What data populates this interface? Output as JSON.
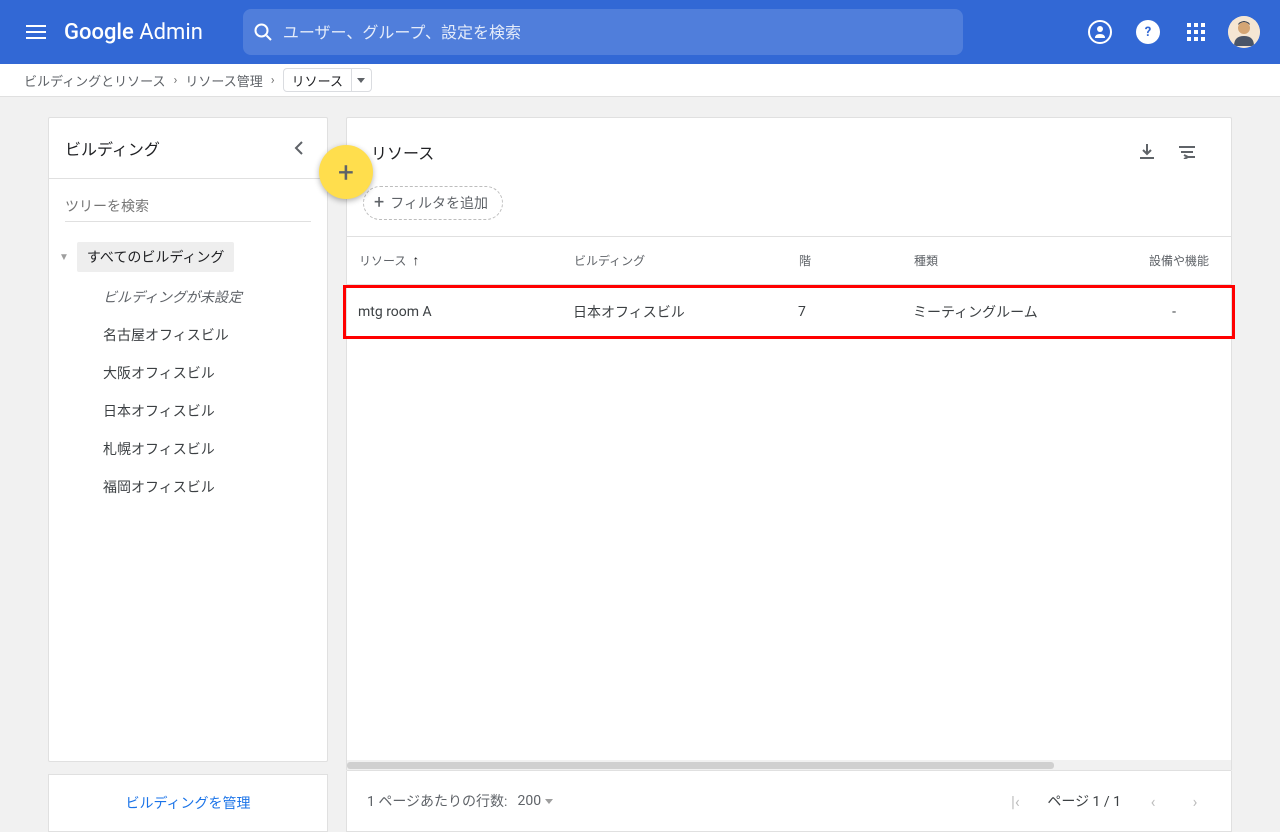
{
  "header": {
    "logo_a": "Google",
    "logo_b": "Admin",
    "search_placeholder": "ユーザー、グループ、設定を検索"
  },
  "breadcrumb": {
    "items": [
      "ビルディングとリソース",
      "リソース管理"
    ],
    "current": "リソース"
  },
  "sidebar": {
    "title": "ビルディング",
    "search_placeholder": "ツリーを検索",
    "root": "すべてのビルディング",
    "items": [
      {
        "label": "ビルディングが未設定",
        "italic": true
      },
      {
        "label": "名古屋オフィスビル",
        "italic": false
      },
      {
        "label": "大阪オフィスビル",
        "italic": false
      },
      {
        "label": "日本オフィスビル",
        "italic": false
      },
      {
        "label": "札幌オフィスビル",
        "italic": false
      },
      {
        "label": "福岡オフィスビル",
        "italic": false
      }
    ],
    "manage_link": "ビルディングを管理"
  },
  "content": {
    "title": "リソース",
    "filter_label": "フィルタを追加",
    "columns": {
      "resource": "リソース",
      "building": "ビルディング",
      "floor": "階",
      "type": "種類",
      "features": "設備や機能"
    },
    "rows": [
      {
        "resource": "mtg room A",
        "building": "日本オフィスビル",
        "floor": "7",
        "type": "ミーティングルーム",
        "features": "-"
      }
    ]
  },
  "pagination": {
    "rows_label": "1 ページあたりの行数:",
    "rows_value": "200",
    "page_info": "ページ 1 / 1"
  }
}
